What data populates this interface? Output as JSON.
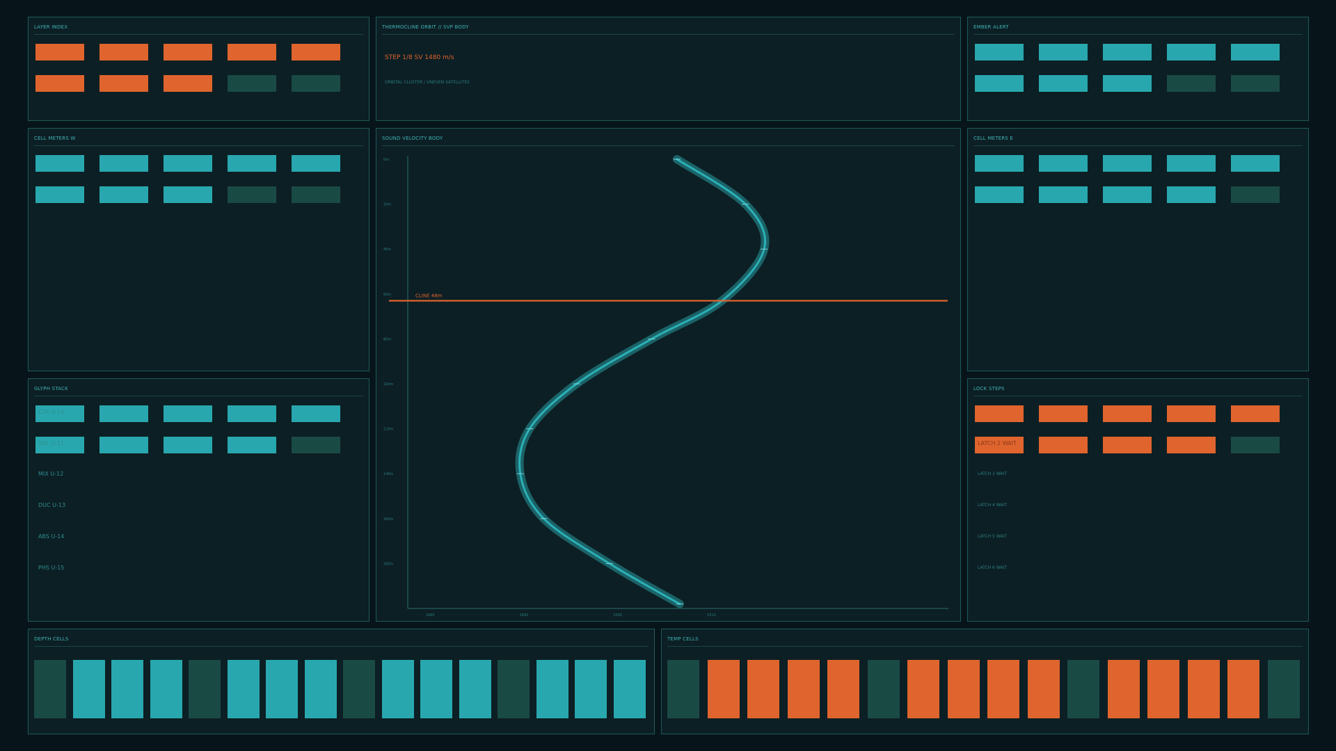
{
  "colors": {
    "background": "#07151a",
    "panel": "#0c1f24",
    "border": "#1f5a5a",
    "teal": "#28a8ae",
    "orange": "#e0642e",
    "dim": "#1a4a44"
  },
  "panels": {
    "layer_index": {
      "title": "LAYER INDEX",
      "blocks": [
        {
          "color": "orange"
        },
        {
          "color": "orange"
        },
        {
          "color": "orange"
        },
        {
          "color": "orange"
        },
        {
          "color": "orange"
        },
        {
          "color": "orange"
        },
        {
          "color": "orange"
        },
        {
          "color": "orange"
        },
        {
          "color": "dim"
        },
        {
          "color": "dim"
        }
      ]
    },
    "header": {
      "title": "THERMOCLINE ORBIT  //  SVP BODY",
      "step_text": "STEP 1/8   SV 1480 m/s",
      "subtitle": "ORBITAL CLUSTER  /  UNEVEN SATELLITES"
    },
    "ember_alert": {
      "title": "EMBER ALERT",
      "blocks": [
        {
          "color": "teal"
        },
        {
          "color": "teal"
        },
        {
          "color": "teal"
        },
        {
          "color": "teal"
        },
        {
          "color": "teal"
        },
        {
          "color": "teal"
        },
        {
          "color": "teal"
        },
        {
          "color": "teal"
        },
        {
          "color": "dim"
        },
        {
          "color": "dim"
        }
      ]
    },
    "cell_meters_w": {
      "title": "CELL METERS W",
      "blocks": [
        {
          "color": "teal"
        },
        {
          "color": "teal"
        },
        {
          "color": "teal"
        },
        {
          "color": "teal"
        },
        {
          "color": "teal"
        },
        {
          "color": "teal"
        },
        {
          "color": "teal"
        },
        {
          "color": "teal"
        },
        {
          "color": "dim"
        },
        {
          "color": "dim"
        }
      ]
    },
    "cell_meters_e": {
      "title": "CELL METERS E",
      "blocks": [
        {
          "color": "teal"
        },
        {
          "color": "teal"
        },
        {
          "color": "teal"
        },
        {
          "color": "teal"
        },
        {
          "color": "teal"
        },
        {
          "color": "teal"
        },
        {
          "color": "teal"
        },
        {
          "color": "teal"
        },
        {
          "color": "teal"
        },
        {
          "color": "dim"
        }
      ]
    },
    "glyph_stack": {
      "title": "GLYPH STACK",
      "blocks": [
        {
          "color": "teal",
          "label": "CLR U-10"
        },
        {
          "color": "teal"
        },
        {
          "color": "teal"
        },
        {
          "color": "teal"
        },
        {
          "color": "teal"
        },
        {
          "color": "teal",
          "label": "SNL U-11"
        },
        {
          "color": "teal"
        },
        {
          "color": "teal"
        },
        {
          "color": "teal"
        },
        {
          "color": "dim"
        }
      ],
      "stack_labels": [
        "MIX U-12",
        "DUC U-13",
        "ABS U-14",
        "PHS U-15"
      ]
    },
    "lock_steps": {
      "title": "LOCK STEPS",
      "blocks": [
        {
          "color": "orange"
        },
        {
          "color": "orange"
        },
        {
          "color": "orange"
        },
        {
          "color": "orange"
        },
        {
          "color": "orange"
        },
        {
          "color": "orange",
          "label": "LATCH 2 WAIT"
        },
        {
          "color": "orange"
        },
        {
          "color": "orange"
        },
        {
          "color": "orange"
        },
        {
          "color": "dim"
        }
      ],
      "latch_labels": [
        "LATCH 3 WAIT",
        "LATCH 4 WAIT",
        "LATCH 5 WAIT",
        "LATCH 6 WAIT"
      ]
    },
    "depth_cells": {
      "title": "DEPTH CELLS",
      "cells": [
        "dim",
        "teal",
        "teal",
        "teal",
        "dim",
        "teal",
        "teal",
        "teal",
        "dim",
        "teal",
        "teal",
        "teal",
        "dim",
        "teal",
        "teal",
        "teal"
      ]
    },
    "temp_cells": {
      "title": "TEMP CELLS",
      "cells": [
        "dim",
        "orange",
        "orange",
        "orange",
        "orange",
        "dim",
        "orange",
        "orange",
        "orange",
        "orange",
        "dim",
        "orange",
        "orange",
        "orange",
        "orange",
        "dim"
      ]
    }
  },
  "chart_data": {
    "type": "line",
    "title": "SOUND VELOCITY BODY",
    "xlabel": "",
    "ylabel": "",
    "y_ticks": [
      "0m",
      "20m",
      "40m",
      "60m",
      "80m",
      "100m",
      "120m",
      "140m",
      "160m",
      "180m"
    ],
    "x_ticks": [
      1480,
      1490,
      1500,
      1510
    ],
    "xlim": [
      1477.5,
      1535
    ],
    "ylim": [
      0,
      200
    ],
    "y_inverted": true,
    "thermocline": {
      "label": "CLINE 48m",
      "depth": 63
    },
    "series": [
      {
        "points": [
          {
            "x": 1506.2,
            "y": 0
          },
          {
            "x": 1513.5,
            "y": 20
          },
          {
            "x": 1515.5,
            "y": 40
          },
          {
            "x": 1511.0,
            "y": 63
          },
          {
            "x": 1503.5,
            "y": 80
          },
          {
            "x": 1495.5,
            "y": 100
          },
          {
            "x": 1490.5,
            "y": 120
          },
          {
            "x": 1489.5,
            "y": 140
          },
          {
            "x": 1492.0,
            "y": 160
          },
          {
            "x": 1499.0,
            "y": 180
          },
          {
            "x": 1506.5,
            "y": 198
          }
        ]
      }
    ]
  }
}
